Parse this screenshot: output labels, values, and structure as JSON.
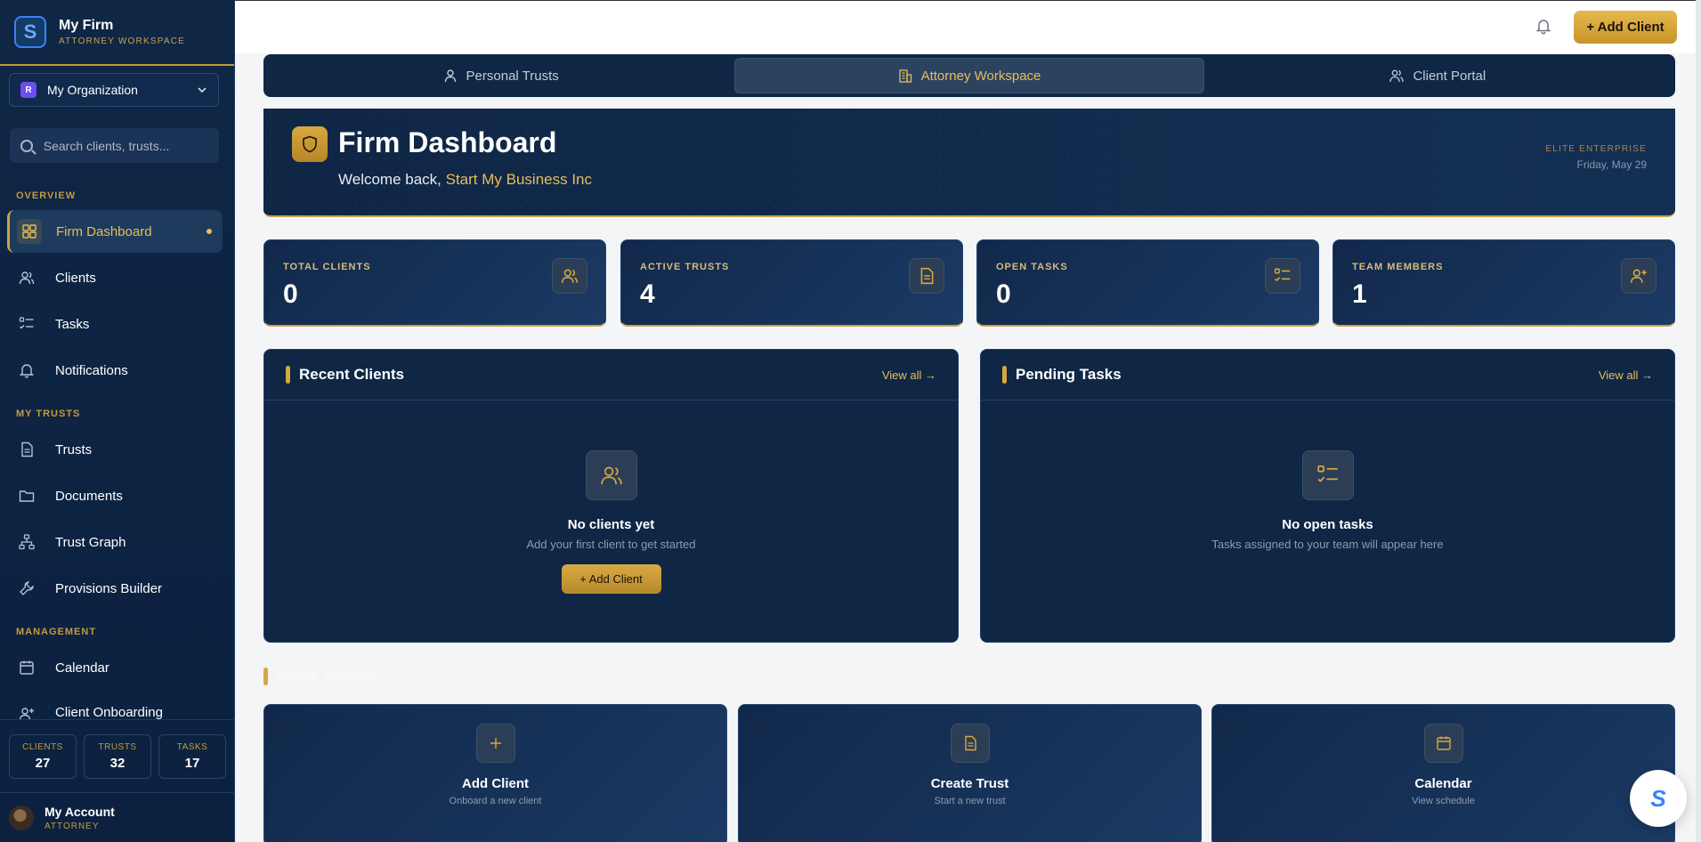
{
  "brand": {
    "title": "My Firm",
    "subtitle": "ATTORNEY WORKSPACE",
    "logo_letter": "S"
  },
  "org": {
    "name": "My Organization",
    "icon_letter": "R"
  },
  "search": {
    "placeholder": "Search clients, trusts..."
  },
  "sections": {
    "overview": "OVERVIEW",
    "my_trusts": "MY TRUSTS",
    "management": "MANAGEMENT"
  },
  "nav": {
    "firm_dashboard": "Firm Dashboard",
    "clients": "Clients",
    "tasks": "Tasks",
    "notifications": "Notifications",
    "trusts": "Trusts",
    "documents": "Documents",
    "trust_graph": "Trust Graph",
    "provisions_builder": "Provisions Builder",
    "calendar": "Calendar",
    "client_onboarding": "Client Onboarding"
  },
  "sidebar_stats": [
    {
      "label": "CLIENTS",
      "value": "27"
    },
    {
      "label": "TRUSTS",
      "value": "32"
    },
    {
      "label": "TASKS",
      "value": "17"
    }
  ],
  "account": {
    "name": "My Account",
    "role": "ATTORNEY"
  },
  "topbar": {
    "add_client": "+ Add Client"
  },
  "tabs": [
    {
      "label": "Personal Trusts",
      "icon": "user-icon"
    },
    {
      "label": "Attorney Workspace",
      "icon": "building-icon"
    },
    {
      "label": "Client Portal",
      "icon": "users-icon"
    }
  ],
  "hero": {
    "title": "Firm Dashboard",
    "welcome_prefix": "Welcome back, ",
    "welcome_name": "Start My Business Inc",
    "tier": "ELITE ENTERPRISE",
    "date": "Friday, May 29"
  },
  "kpis": [
    {
      "label": "TOTAL CLIENTS",
      "value": "0",
      "icon": "users-icon"
    },
    {
      "label": "ACTIVE TRUSTS",
      "value": "4",
      "icon": "document-icon"
    },
    {
      "label": "OPEN TASKS",
      "value": "0",
      "icon": "checklist-icon"
    },
    {
      "label": "TEAM MEMBERS",
      "value": "1",
      "icon": "user-plus-icon"
    }
  ],
  "recent_clients": {
    "title": "Recent Clients",
    "view_all": "View all →",
    "empty_title": "No clients yet",
    "empty_sub": "Add your first client to get started",
    "button": "+ Add Client"
  },
  "pending_tasks": {
    "title": "Pending Tasks",
    "view_all": "View all →",
    "empty_title": "No open tasks",
    "empty_sub": "Tasks assigned to your team will appear here"
  },
  "quick_actions": {
    "title": "Quick Actions",
    "items": [
      {
        "title": "Add Client",
        "sub": "Onboard a new client",
        "icon": "plus-icon"
      },
      {
        "title": "Create Trust",
        "sub": "Start a new trust",
        "icon": "document-icon"
      },
      {
        "title": "Calendar",
        "sub": "View schedule",
        "icon": "calendar-icon"
      }
    ]
  },
  "fab": {
    "letter": "S"
  },
  "colors": {
    "navy": "#0f2645",
    "gold": "#c9a24a",
    "gold_text": "#e7bd5c"
  }
}
